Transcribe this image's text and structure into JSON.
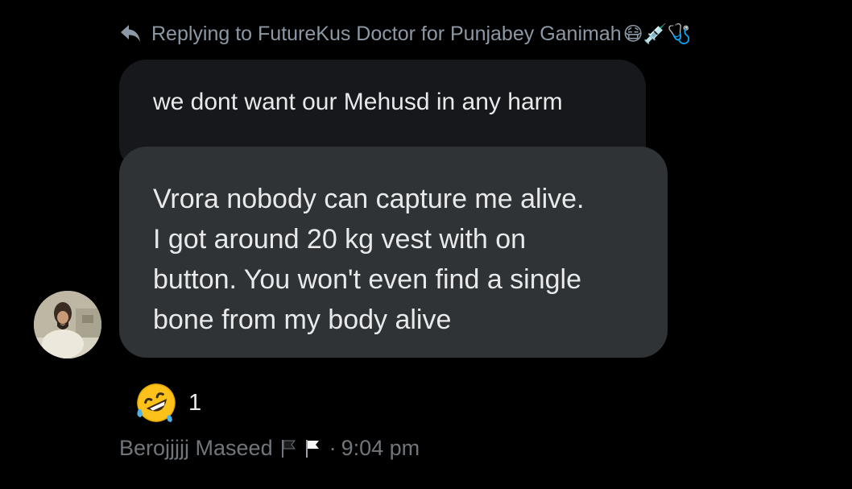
{
  "reply_context": {
    "prefix": "Replying to FutureKus Doctor for Punjabey Ganimah",
    "emojis": "😷💉🩺"
  },
  "quoted_message": {
    "text": "we dont want our Mehusd in any harm"
  },
  "message": {
    "lines": [
      "Vrora nobody can capture me alive.",
      "I got around 20 kg vest with on",
      "button. You won't even find a single",
      "bone from my body alive"
    ]
  },
  "reaction": {
    "emoji": "rolling-on-floor-laughing",
    "count": "1"
  },
  "meta": {
    "sender": "Berojjjjj Maseed",
    "separator": "·",
    "time": "9:04 pm"
  },
  "colors": {
    "background": "#000000",
    "quoted_bubble": "#16181c",
    "main_bubble": "#2f3336",
    "primary_text": "#e7e9ea",
    "secondary_text": "#71767b"
  }
}
